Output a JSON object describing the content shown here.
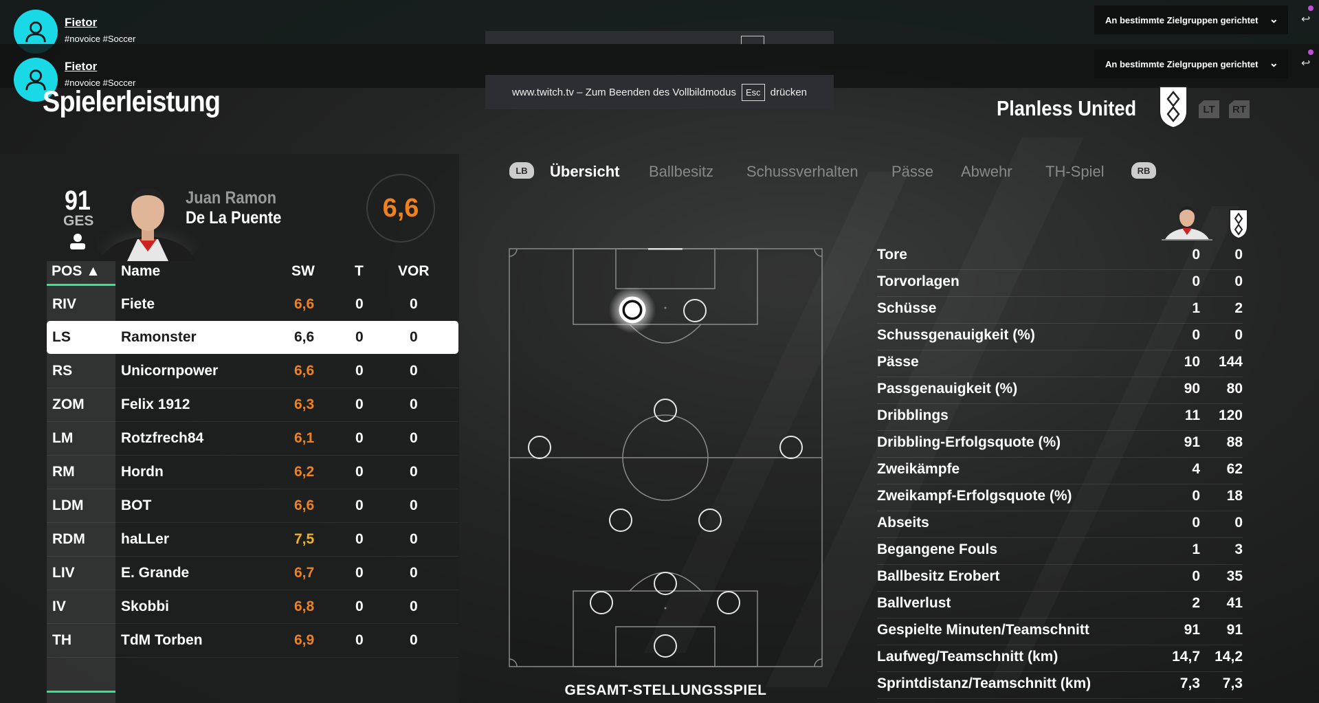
{
  "overlay": {
    "streamer": "Fietor",
    "tags": "#novoice #Soccer",
    "audience_label": "An bestimmte Zielgruppen gerichtet",
    "fullscreen_msg_prefix": "www.twitch.tv – Zum Beenden des Vollbildmodus",
    "fullscreen_key": "Esc",
    "fullscreen_msg_suffix": "drücken"
  },
  "page_title": "Spielerleistung",
  "team": {
    "name": "Planless United",
    "trigger_left": "LT",
    "trigger_right": "RT"
  },
  "player": {
    "overall": "91",
    "overall_label": "GES",
    "first_name": "Juan Ramon",
    "last_name": "De La Puente",
    "rating": "6,6"
  },
  "table": {
    "headers": {
      "pos": "POS ▲",
      "name": "Name",
      "sw": "SW",
      "t": "T",
      "vor": "VOR"
    },
    "rows": [
      {
        "pos": "RIV",
        "name": "Fiete",
        "sw": "6,6",
        "t": "0",
        "vor": "0"
      },
      {
        "pos": "LS",
        "name": "Ramonster",
        "sw": "6,6",
        "t": "0",
        "vor": "0"
      },
      {
        "pos": "RS",
        "name": "Unicornpower",
        "sw": "6,6",
        "t": "0",
        "vor": "0"
      },
      {
        "pos": "ZOM",
        "name": "Felix 1912",
        "sw": "6,3",
        "t": "0",
        "vor": "0"
      },
      {
        "pos": "LM",
        "name": "Rotzfrech84",
        "sw": "6,1",
        "t": "0",
        "vor": "0"
      },
      {
        "pos": "RM",
        "name": "Hordn",
        "sw": "6,2",
        "t": "0",
        "vor": "0"
      },
      {
        "pos": "LDM",
        "name": "BOT",
        "sw": "6,6",
        "t": "0",
        "vor": "0"
      },
      {
        "pos": "RDM",
        "name": "haLLer",
        "sw": "7,5",
        "t": "0",
        "vor": "0"
      },
      {
        "pos": "LIV",
        "name": "E. Grande",
        "sw": "6,7",
        "t": "0",
        "vor": "0"
      },
      {
        "pos": "IV",
        "name": "Skobbi",
        "sw": "6,8",
        "t": "0",
        "vor": "0"
      },
      {
        "pos": "TH",
        "name": "TdM Torben",
        "sw": "6,9",
        "t": "0",
        "vor": "0"
      }
    ]
  },
  "tabs": {
    "bumper_left": "LB",
    "bumper_right": "RB",
    "items": [
      "Übersicht",
      "Ballbesitz",
      "Schussverhalten",
      "Pässe",
      "Abwehr",
      "TH-Spiel"
    ]
  },
  "pitch_label": "GESAMT-STELLUNGSSPIEL",
  "stats": [
    {
      "label": "Tore",
      "player": "0",
      "team": "0"
    },
    {
      "label": "Torvorlagen",
      "player": "0",
      "team": "0"
    },
    {
      "label": "Schüsse",
      "player": "1",
      "team": "2"
    },
    {
      "label": "Schussgenauigkeit (%)",
      "player": "0",
      "team": "0"
    },
    {
      "label": "Pässe",
      "player": "10",
      "team": "144"
    },
    {
      "label": "Passgenauigkeit (%)",
      "player": "90",
      "team": "80"
    },
    {
      "label": "Dribblings",
      "player": "11",
      "team": "120"
    },
    {
      "label": "Dribbling-Erfolgsquote (%)",
      "player": "91",
      "team": "88"
    },
    {
      "label": "Zweikämpfe",
      "player": "4",
      "team": "62"
    },
    {
      "label": "Zweikampf-Erfolgsquote (%)",
      "player": "0",
      "team": "18"
    },
    {
      "label": "Abseits",
      "player": "0",
      "team": "0"
    },
    {
      "label": "Begangene Fouls",
      "player": "1",
      "team": "3"
    },
    {
      "label": "Ballbesitz Erobert",
      "player": "0",
      "team": "35"
    },
    {
      "label": "Ballverlust",
      "player": "2",
      "team": "41"
    },
    {
      "label": "Gespielte Minuten/Teamschnitt",
      "player": "91",
      "team": "91"
    },
    {
      "label": "Laufweg/Teamschnitt (km)",
      "player": "14,7",
      "team": "14,2"
    },
    {
      "label": "Sprintdistanz/Teamschnitt (km)",
      "player": "7,3",
      "team": "7,3"
    }
  ],
  "colors": {
    "rating": "#f0821e",
    "accent": "#2ee88a",
    "avatar": "#19d9e6"
  }
}
